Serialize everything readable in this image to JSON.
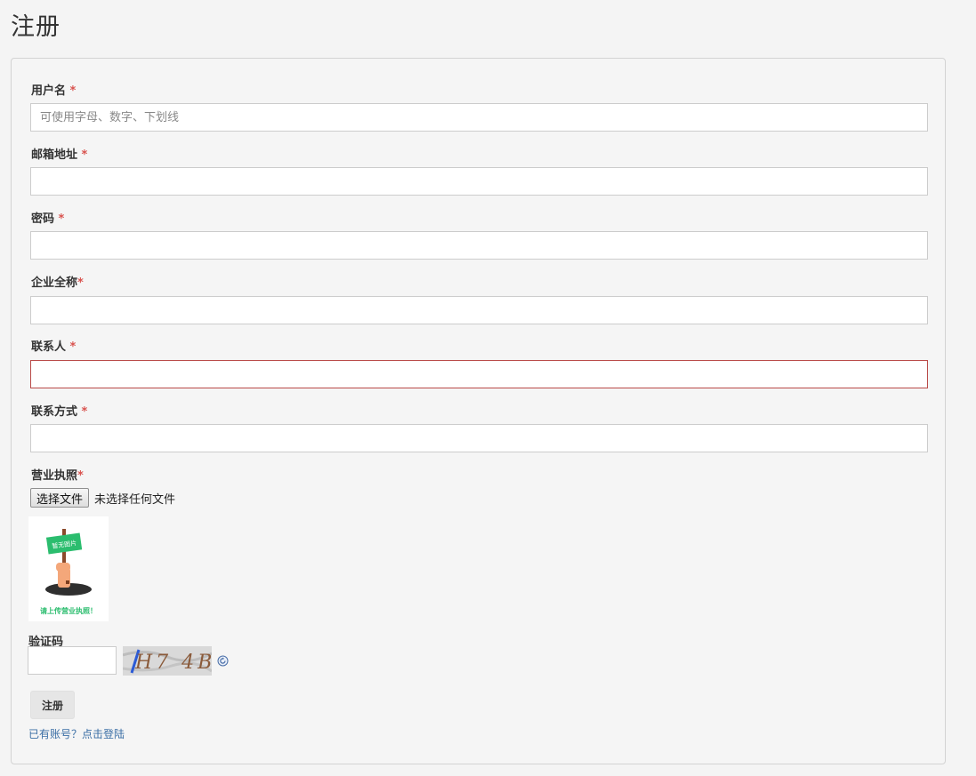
{
  "page": {
    "title": "注册"
  },
  "form": {
    "required_mark": "*",
    "username": {
      "label": "用户名",
      "placeholder": "可使用字母、数字、下划线",
      "value": ""
    },
    "email": {
      "label": "邮箱地址",
      "value": ""
    },
    "password": {
      "label": "密码",
      "value": ""
    },
    "company": {
      "label": "企业全称",
      "value": ""
    },
    "contact_person": {
      "label": "联系人",
      "value": ""
    },
    "contact_info": {
      "label": "联系方式",
      "value": ""
    },
    "business_license": {
      "label": "营业执照",
      "choose_button": "选择文件",
      "file_status": "未选择任何文件",
      "preview": {
        "sign_text": "暂无图片",
        "caption": "请上传营业执照！"
      }
    },
    "captcha": {
      "label": "验证码",
      "value": "",
      "image_text": "H7 4B"
    },
    "submit_label": "注册",
    "login_link": "已有账号？点击登陆"
  },
  "colors": {
    "required": "#d9534f",
    "error_border": "#b94a48",
    "link": "#3a6ea5",
    "sign_green": "#2bbd6e"
  },
  "icons": {
    "refresh": "refresh-icon"
  }
}
